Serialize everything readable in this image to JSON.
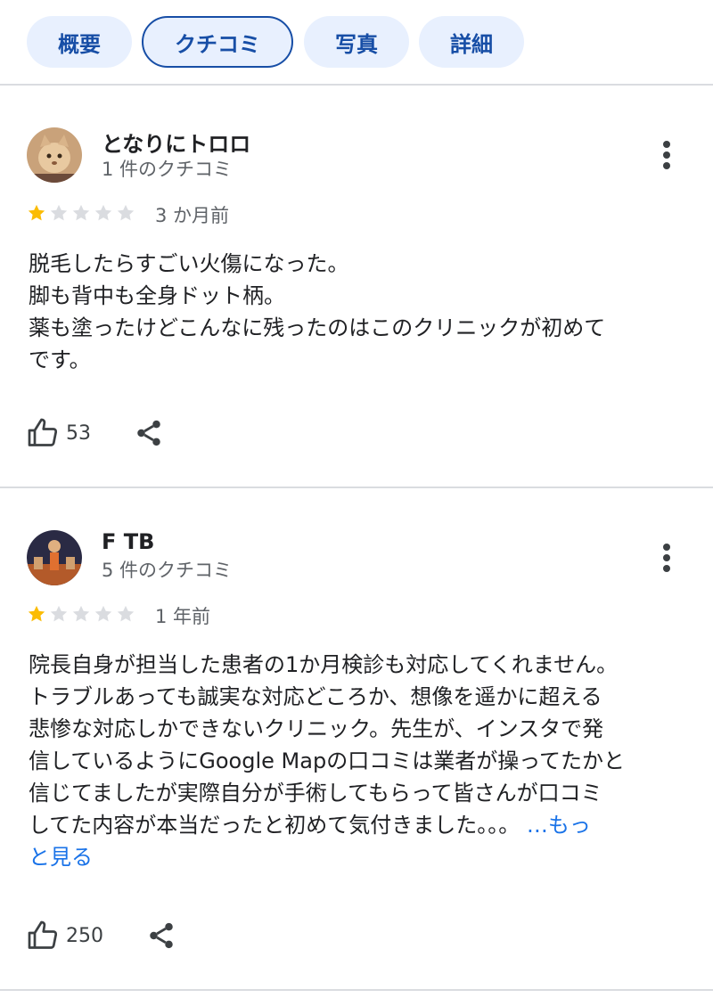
{
  "tabs": [
    {
      "label": "概要"
    },
    {
      "label": "クチコミ"
    },
    {
      "label": "写真"
    },
    {
      "label": "詳細"
    }
  ],
  "reviews": [
    {
      "name": "となりにトロロ",
      "count": "1 件のクチコミ",
      "rating": 1,
      "date": "3 か月前",
      "lines": [
        "脱毛したらすごい火傷になった。",
        "脚も背中も全身ドット柄。",
        "薬も塗ったけどこんなに残ったのはこのクリニックが初めて",
        "です。"
      ],
      "likes": "53"
    },
    {
      "name": "F TB",
      "count": "5 件のクチコミ",
      "rating": 1,
      "date": "1 年前",
      "lines": [
        "院長自身が担当した患者の1か月検診も対応してくれません。",
        "トラブルあっても誠実な対応どころか、想像を遥かに超える",
        "悲惨な対応しかできないクリニック。先生が、インスタで発",
        "信しているようにGoogle Mapの口コミは業者が操ってたかと",
        "信じてましたが実際自分が手術してもらって皆さんが口コミ",
        "してた内容が本当だったと初めて気付きました。。。 "
      ],
      "more_label_1": "…もっ",
      "more_label_2": "と見る",
      "likes": "250"
    }
  ],
  "colors": {
    "accent": "#174ea6",
    "link": "#1a73e8",
    "star_filled": "#fbbc04",
    "star_empty": "#dadce0"
  }
}
